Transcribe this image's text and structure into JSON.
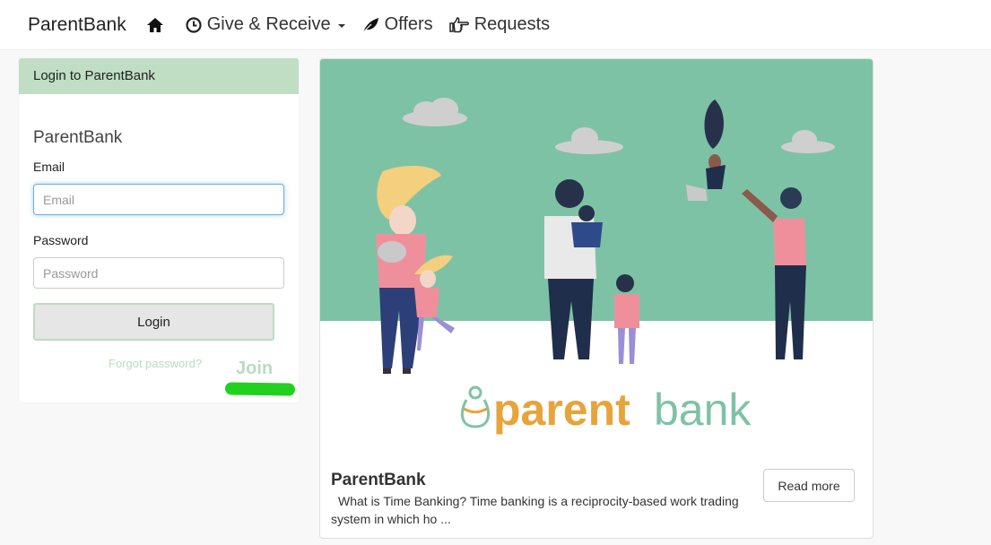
{
  "nav": {
    "brand": "ParentBank",
    "give_receive": "Give & Receive",
    "offers": "Offers",
    "requests": "Requests"
  },
  "login": {
    "header": "Login to ParentBank",
    "title": "ParentBank",
    "email_label": "Email",
    "email_placeholder": "Email",
    "email_value": "",
    "password_label": "Password",
    "password_placeholder": "Password",
    "password_value": "",
    "login_button": "Login",
    "forgot_link": "Forgot password?",
    "join_link": "Join"
  },
  "card": {
    "logo_text_bold": "parent",
    "logo_text_light": "bank",
    "title": "ParentBank",
    "description": "What is Time Banking? Time banking is a reciprocity-based work trading system in which ho ...",
    "read_more": "Read more"
  },
  "colors": {
    "hero_green": "#7ec2a6",
    "logo_orange": "#e7a43b",
    "logo_green": "#7ec2a6",
    "panel_header": "#bfdec4",
    "join_highlight": "#22d020"
  },
  "icons": {
    "home": "home-icon",
    "give_receive": "clock-icon",
    "offers": "leaf-icon",
    "requests": "hand-point-right-icon"
  }
}
